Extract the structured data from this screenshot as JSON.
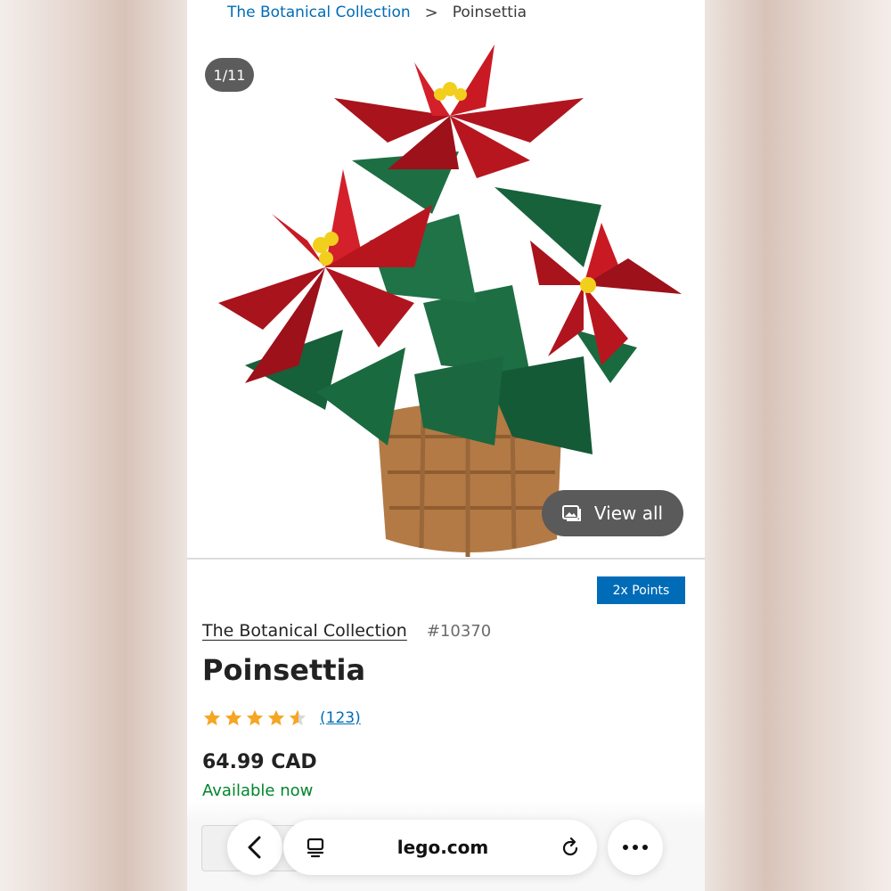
{
  "breadcrumb": {
    "parent": "The Botanical Collection",
    "separator": ">",
    "current": "Poinsettia"
  },
  "gallery": {
    "counter": "1/11",
    "view_all_label": "View all"
  },
  "badge": {
    "points": "2x Points"
  },
  "product": {
    "theme": "The Botanical Collection",
    "set_number": "#10370",
    "title": "Poinsettia",
    "rating": 4.5,
    "review_count": "(123)",
    "price": "64.99 CAD",
    "availability": "Available now"
  },
  "browser": {
    "url": "lego.com"
  },
  "icons": {
    "back": "chevron-left-icon",
    "tabs": "tabs-icon",
    "reload": "reload-icon",
    "more": "more-icon",
    "image": "image-icon",
    "star": "star-icon"
  },
  "colors": {
    "link_blue": "#006cb7",
    "available_green": "#00852b",
    "star_gold": "#f5a623",
    "badge_blue": "#006cb7"
  }
}
